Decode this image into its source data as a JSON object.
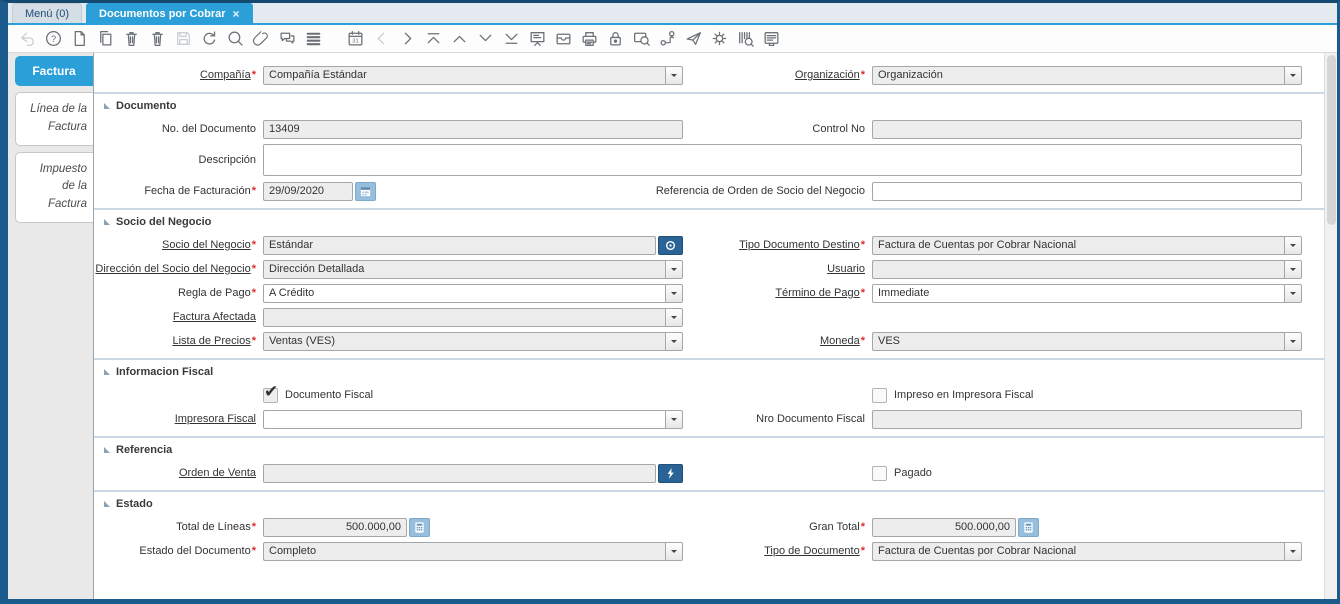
{
  "colors": {
    "accent": "#2b9fd8",
    "frame": "#1b5a8c",
    "dark_button": "#2a6496",
    "light_button": "#97bedc",
    "required_mark": "#d9302c",
    "sidebar_bg": "#e9e9e9"
  },
  "window": {
    "tabs": [
      {
        "name": "menu-tab",
        "label": "Menú (0)",
        "active": false,
        "closable": false
      },
      {
        "name": "documentos-por-cobrar-tab",
        "label": "Documentos por Cobrar",
        "active": true,
        "closable": true,
        "close_glyph": "×"
      }
    ]
  },
  "toolbar": {
    "icons": [
      {
        "name": "undo-icon",
        "enabled": false
      },
      {
        "name": "help-icon",
        "enabled": true
      },
      {
        "name": "new-record-icon",
        "enabled": true
      },
      {
        "name": "copy-record-icon",
        "enabled": true
      },
      {
        "name": "delete-record-icon",
        "enabled": true
      },
      {
        "name": "delete-selection-icon",
        "enabled": true
      },
      {
        "name": "save-icon",
        "enabled": false
      },
      {
        "name": "refresh-icon",
        "enabled": true
      },
      {
        "name": "find-icon",
        "enabled": true
      },
      {
        "name": "attachment-icon",
        "enabled": true
      },
      {
        "name": "chat-icon",
        "enabled": true
      },
      {
        "name": "toggle-grid-icon",
        "enabled": true
      },
      {
        "name": "calendar-icon",
        "enabled": true,
        "gap_before": true
      },
      {
        "name": "parent-record-icon",
        "enabled": false
      },
      {
        "name": "detail-record-icon",
        "enabled": true
      },
      {
        "name": "first-record-icon",
        "enabled": true
      },
      {
        "name": "previous-record-icon",
        "enabled": true
      },
      {
        "name": "next-record-icon",
        "enabled": true
      },
      {
        "name": "last-record-icon",
        "enabled": true
      },
      {
        "name": "report-icon",
        "enabled": true
      },
      {
        "name": "archive-icon",
        "enabled": true
      },
      {
        "name": "print-icon",
        "enabled": true
      },
      {
        "name": "lock-icon",
        "enabled": true
      },
      {
        "name": "zoom-across-icon",
        "enabled": true
      },
      {
        "name": "workflow-icon",
        "enabled": true
      },
      {
        "name": "request-icon",
        "enabled": true
      },
      {
        "name": "process-icon",
        "enabled": true
      },
      {
        "name": "product-info-icon",
        "enabled": true
      },
      {
        "name": "window-report-icon",
        "enabled": true
      }
    ]
  },
  "sidebar": {
    "tabs": [
      {
        "name": "tab-factura",
        "label": "Factura",
        "active": true
      },
      {
        "name": "tab-linea-de-la-factura",
        "label": "Línea de la Factura",
        "active": false
      },
      {
        "name": "tab-impuesto-de-la-factura",
        "label": "Impuesto de la Factura",
        "active": false
      }
    ]
  },
  "form": {
    "sections": [
      {
        "title": null,
        "rows": [
          {
            "left": {
              "name": "company",
              "label": "Compañía",
              "required": true,
              "underlined": true,
              "widget": "select",
              "value": "Compañía Estándar",
              "disabled": true
            },
            "right": {
              "name": "organization",
              "label": "Organización",
              "required": true,
              "underlined": true,
              "widget": "select",
              "value": "Organización",
              "disabled": true
            }
          }
        ]
      },
      {
        "title": "Documento",
        "rows": [
          {
            "left": {
              "name": "document-no",
              "label": "No. del Documento",
              "widget": "text",
              "value": "13409",
              "disabled": true
            },
            "right": {
              "name": "control-no",
              "label": "Control No",
              "widget": "text",
              "value": "",
              "disabled": true
            }
          },
          {
            "left": {
              "name": "description",
              "label": "Descripción",
              "widget": "textarea",
              "value": ""
            }
          },
          {
            "left": {
              "name": "invoice-date",
              "label": "Fecha de Facturación",
              "required": true,
              "widget": "date",
              "value": "29/09/2020",
              "disabled": true,
              "button": "calendar"
            },
            "right": {
              "name": "bp-order-reference",
              "label": "Referencia de Orden de Socio del Negocio",
              "widget": "text",
              "value": ""
            }
          }
        ]
      },
      {
        "title": "Socio del Negocio",
        "rows": [
          {
            "left": {
              "name": "business-partner",
              "label": "Socio del Negocio",
              "required": true,
              "underlined": true,
              "widget": "text",
              "value": "Estándar",
              "disabled": true,
              "button": "bp-search"
            },
            "right": {
              "name": "target-document-type",
              "label": "Tipo Documento Destino",
              "required": true,
              "underlined": true,
              "widget": "select",
              "value": "Factura de Cuentas por Cobrar Nacional",
              "disabled": true
            }
          },
          {
            "left": {
              "name": "partner-address",
              "label": "Dirección del Socio del Negocio",
              "required": true,
              "underlined": true,
              "widget": "select",
              "value": "Dirección Detallada",
              "disabled": true
            },
            "right": {
              "name": "user",
              "label": "Usuario",
              "underlined": true,
              "widget": "select",
              "value": "",
              "disabled": true
            }
          },
          {
            "left": {
              "name": "payment-rule",
              "label": "Regla de Pago",
              "required": true,
              "widget": "select",
              "value": "A Crédito"
            },
            "right": {
              "name": "payment-term",
              "label": "Término de Pago",
              "required": true,
              "underlined": true,
              "widget": "select",
              "value": "Immediate"
            }
          },
          {
            "left": {
              "name": "affected-invoice",
              "label": "Factura Afectada",
              "underlined": true,
              "widget": "select",
              "value": "",
              "disabled": true
            }
          },
          {
            "left": {
              "name": "price-list",
              "label": "Lista de Precios",
              "required": true,
              "underlined": true,
              "widget": "select",
              "value": "Ventas (VES)",
              "disabled": true
            },
            "right": {
              "name": "currency",
              "label": "Moneda",
              "required": true,
              "underlined": true,
              "widget": "select",
              "value": "VES",
              "disabled": true
            }
          }
        ]
      },
      {
        "title": "Informacion Fiscal",
        "rows": [
          {
            "left": {
              "name": "fiscal-document",
              "widget": "checkbox",
              "checked": true,
              "label": "Documento Fiscal"
            },
            "right": {
              "name": "printed-on-fiscal-printer",
              "widget": "checkbox",
              "checked": false,
              "label": "Impreso en Impresora Fiscal"
            }
          },
          {
            "left": {
              "name": "fiscal-printer",
              "label": "Impresora Fiscal",
              "underlined": true,
              "widget": "select",
              "value": ""
            },
            "right": {
              "name": "fiscal-document-no",
              "label": "Nro Documento Fiscal",
              "widget": "text",
              "value": "",
              "disabled": true
            }
          }
        ]
      },
      {
        "title": "Referencia",
        "rows": [
          {
            "left": {
              "name": "sales-order",
              "label": "Orden de Venta",
              "underlined": true,
              "widget": "text",
              "value": "",
              "disabled": true,
              "button": "zoom"
            },
            "right": {
              "name": "paid",
              "widget": "checkbox",
              "checked": false,
              "label": "Pagado"
            }
          }
        ]
      },
      {
        "title": "Estado",
        "rows": [
          {
            "left": {
              "name": "total-lines",
              "label": "Total de Líneas",
              "required": true,
              "widget": "amount",
              "value": "500.000,00",
              "disabled": true,
              "button": "calc"
            },
            "right": {
              "name": "grand-total",
              "label": "Gran Total",
              "required": true,
              "widget": "amount",
              "value": "500.000,00",
              "disabled": true,
              "button": "calc"
            }
          },
          {
            "left": {
              "name": "document-status",
              "label": "Estado del Documento",
              "required": true,
              "widget": "select",
              "value": "Completo",
              "disabled": true
            },
            "right": {
              "name": "document-type",
              "label": "Tipo de Documento",
              "required": true,
              "underlined": true,
              "widget": "select",
              "value": "Factura de Cuentas por Cobrar Nacional",
              "disabled": true
            }
          }
        ]
      }
    ]
  }
}
